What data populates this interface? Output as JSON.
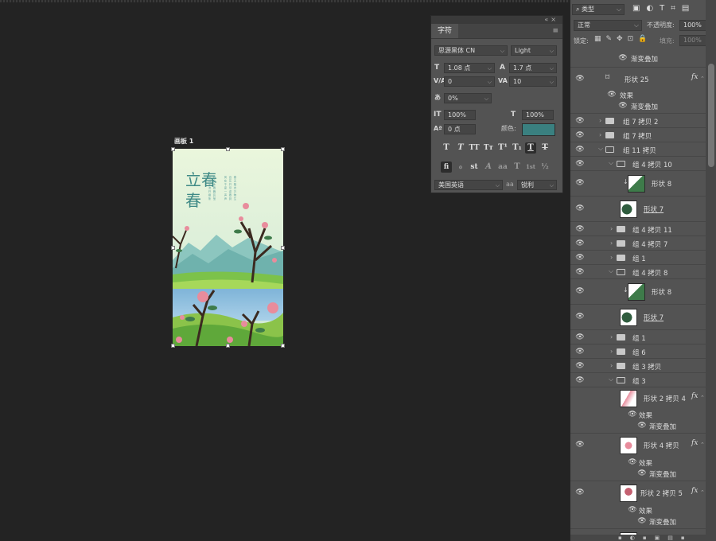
{
  "artboard": {
    "label": "画板 1",
    "title_text": "立春",
    "poem_lines": [
      "雨 细 风 流 开 柳 条",
      "枝 鸟 木 春 舞 宾 莹",
      "风 在 千 家 一 声 声",
      "百 花 开 尽 迎 春 到",
      "春 天 融 合 万 物 生"
    ]
  },
  "character_panel": {
    "tab": "字符",
    "menu_icon": "menu-icon",
    "font_family": "思源黑体 CN",
    "font_style": "Light",
    "font_size": "1.08 点",
    "leading": "1.7 点",
    "kerning": "0",
    "tracking": "10",
    "tsume": "0%",
    "vertical_scale": "100%",
    "horizontal_scale": "100%",
    "baseline_shift": "0 点",
    "color_label": "颜色:",
    "color_swatch": "#3a8080",
    "type_buttons": [
      "T",
      "T",
      "TT",
      "Tт",
      "T¹",
      "T₁",
      "T",
      "T"
    ],
    "opentype_buttons": [
      "fi",
      "ℴ",
      "st",
      "A",
      "aa",
      "T",
      "1st",
      "½"
    ],
    "language": "美国英语",
    "antialias": "锐利"
  },
  "layers_panel": {
    "filter_label": "类型",
    "blend_mode": "正常",
    "opacity_label": "不透明度:",
    "opacity_value": "100%",
    "lock_label": "锁定:",
    "fill_label": "填充:",
    "fill_value": "100%",
    "rows": [
      {
        "name": "渐变叠加"
      },
      {
        "name": "形状 25"
      },
      {
        "name": "效果"
      },
      {
        "name": "渐变叠加"
      },
      {
        "name": "组 7 拷贝 2"
      },
      {
        "name": "组 7 拷贝"
      },
      {
        "name": "组 11 拷贝"
      },
      {
        "name": "组 4 拷贝 10"
      },
      {
        "name": "形状 8"
      },
      {
        "name": "形状 7"
      },
      {
        "name": "组 4 拷贝 11"
      },
      {
        "name": "组 4 拷贝 7"
      },
      {
        "name": "组 1"
      },
      {
        "name": "组 4 拷贝 8"
      },
      {
        "name": "形状 8"
      },
      {
        "name": "形状 7"
      },
      {
        "name": "组 1"
      },
      {
        "name": "组 6"
      },
      {
        "name": "组 3 拷贝"
      },
      {
        "name": "组 3"
      },
      {
        "name": "形状 2 拷贝 4"
      },
      {
        "name": "效果"
      },
      {
        "name": "渐变叠加"
      },
      {
        "name": "形状 4 拷贝"
      },
      {
        "name": "效果"
      },
      {
        "name": "渐变叠加"
      },
      {
        "name": "形状 2 拷贝 5"
      },
      {
        "name": "效果"
      },
      {
        "name": "渐变叠加"
      }
    ]
  },
  "colors": {
    "canvas_bg": "#232323",
    "panel_bg": "#535353",
    "accent_teal": "#3a8080"
  }
}
